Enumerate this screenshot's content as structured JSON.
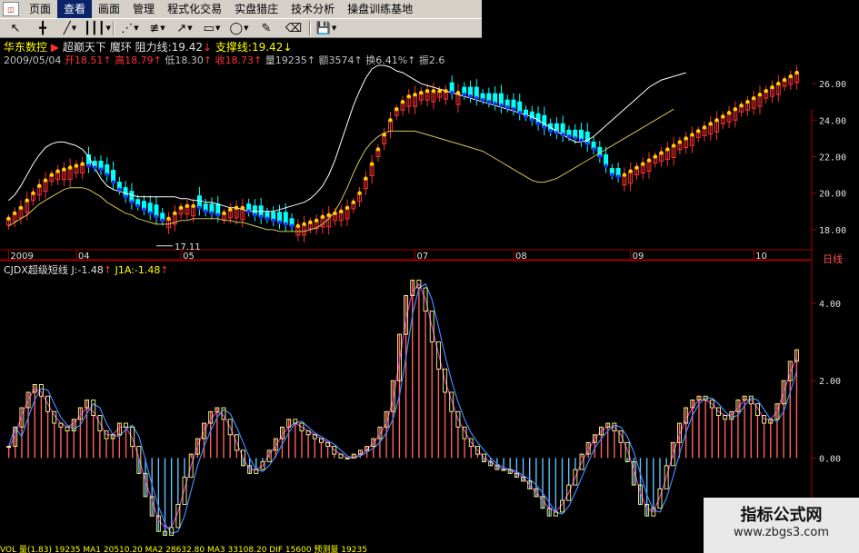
{
  "menu": {
    "items": [
      "页面",
      "查看",
      "画面",
      "管理",
      "程式化交易",
      "实盘猎庄",
      "技术分析",
      "操盘训练基地"
    ],
    "active_index": 1
  },
  "toolbar": {
    "tools": [
      "select-arrow-icon",
      "cross-icon",
      "line-icon",
      "bars-icon",
      "fan-icon",
      "channel-icon",
      "arrow-icon",
      "rect-icon",
      "ellipse-icon",
      "pen-icon",
      "eraser-icon",
      "save-icon"
    ]
  },
  "info": {
    "stock_name": "华东数控",
    "marker": "▶",
    "formula_name": "超巅天下",
    "sub_name": "魔环",
    "resistance_label": "阻力线",
    "resistance_value": "19.42",
    "resistance_arrow": "↓",
    "support_label": "支撑线",
    "support_value": "19.42",
    "support_arrow": "↓",
    "date": "2009/05/04",
    "open_label": "开",
    "open": "18.51",
    "open_arrow": "↑",
    "high_label": "高",
    "high": "18.79",
    "high_arrow": "↑",
    "low_label": "低",
    "low": "18.30",
    "low_arrow": "↑",
    "close_label": "收",
    "close": "18.73",
    "close_arrow": "↑",
    "vol_label": "量",
    "vol": "19235",
    "vol_arrow": "↑",
    "amt_label": "额",
    "amt": "3574",
    "amt_arrow": "↑",
    "turnover_label": "换",
    "turnover": "6.41%",
    "turnover_arrow": "↑",
    "amp_label": "振",
    "amp": "2.6"
  },
  "indicator": {
    "name": "CJDX超级短线",
    "j_label": "J:",
    "j_value": "-1.48",
    "j_arrow": "↑",
    "j1_label": "J1A:",
    "j1_value": "-1.48",
    "j1_arrow": "↑"
  },
  "period_label": "日线",
  "low_annotation": "17.11",
  "watermark": {
    "line1": "指标公式网",
    "line2": "www.zbgs3.com"
  },
  "bottom_text": "VOL 量(1.83)  19235 MA1  20510.20  MA2  28632.80  MA3  33108.20  DIF 15600  预测量  19235",
  "colors": {
    "up": "#ff3030",
    "down": "#00ffff",
    "accent": "#ffff00",
    "band": "#d9c35a",
    "upper": "#ffffff",
    "maup": "#ffd000",
    "madown": "#2233ff",
    "j": "#ffff80",
    "j1": "#cc33cc",
    "j2": "#4488ff",
    "hist_up": "#ff6060",
    "hist_down": "#60c0ff"
  },
  "chart_data": [
    {
      "type": "candlestick",
      "title": "",
      "x_labels": [
        "2009",
        "04",
        "05",
        "07",
        "08",
        "09",
        "10"
      ],
      "y_ticks": [
        18.0,
        20.0,
        22.0,
        24.0,
        26.0
      ],
      "ylim": [
        17.0,
        27.0
      ],
      "grid": false,
      "x": [
        0,
        1,
        2,
        3,
        4,
        5,
        6,
        7,
        8,
        9,
        10,
        11,
        12,
        13,
        14,
        15,
        16,
        17,
        18,
        19,
        20,
        21,
        22,
        23,
        24,
        25,
        26,
        27,
        28,
        29,
        30,
        31,
        32,
        33,
        34,
        35,
        36,
        37,
        38,
        39,
        40,
        41,
        42,
        43,
        44,
        45,
        46,
        47,
        48,
        49,
        50,
        51,
        52,
        53,
        54,
        55,
        56,
        57,
        58,
        59,
        60,
        61,
        62,
        63,
        64,
        65,
        66,
        67,
        68,
        69,
        70,
        71,
        72,
        73,
        74,
        75,
        76,
        77,
        78,
        79,
        80,
        81,
        82,
        83,
        84,
        85,
        86,
        87,
        88,
        89,
        90,
        91,
        92,
        93,
        94,
        95,
        96,
        97,
        98,
        99,
        100,
        101,
        102,
        103,
        104,
        105,
        106,
        107,
        108,
        109,
        110,
        111,
        112,
        113,
        114,
        115,
        116,
        117,
        118,
        119,
        120,
        121,
        122,
        123,
        124,
        125,
        126,
        127,
        128,
        129,
        130,
        131,
        132,
        133,
        134,
        135,
        136,
        137,
        138,
        139,
        140,
        141,
        142,
        143,
        144,
        145,
        146,
        147,
        148,
        149
      ],
      "close": [
        18.6,
        18.9,
        19.2,
        19.6,
        20.0,
        20.4,
        20.7,
        21.0,
        21.2,
        21.3,
        21.4,
        21.5,
        21.6,
        21.5,
        21.4,
        21.3,
        21.0,
        20.6,
        20.2,
        19.8,
        19.5,
        19.3,
        19.1,
        18.9,
        18.7,
        18.5,
        18.6,
        18.9,
        19.2,
        19.3,
        19.3,
        19.2,
        19.0,
        18.9,
        18.8,
        18.9,
        19.1,
        19.2,
        19.2,
        19.0,
        18.8,
        18.7,
        18.6,
        18.5,
        18.4,
        18.3,
        18.2,
        18.2,
        18.3,
        18.4,
        18.5,
        18.7,
        18.8,
        18.9,
        19.0,
        19.2,
        19.5,
        20.0,
        20.8,
        21.6,
        22.4,
        23.2,
        24.0,
        24.6,
        25.0,
        25.3,
        25.4,
        25.5,
        25.6,
        25.6,
        25.6,
        25.6,
        25.5,
        25.5,
        25.4,
        25.3,
        25.2,
        25.1,
        25.0,
        24.9,
        24.8,
        24.7,
        24.6,
        24.4,
        24.2,
        24.0,
        23.8,
        23.6,
        23.4,
        23.3,
        23.2,
        23.1,
        23.0,
        22.9,
        22.7,
        22.4,
        22.0,
        21.5,
        21.0,
        20.9,
        21.0,
        21.2,
        21.4,
        21.6,
        21.8,
        22.0,
        22.2,
        22.4,
        22.6,
        22.8,
        23.0,
        23.2,
        23.4,
        23.6,
        23.8,
        24.0,
        24.2,
        24.4,
        24.6,
        24.8,
        25.0,
        25.2,
        25.4,
        25.6,
        25.8,
        26.0,
        26.2,
        26.4,
        26.6
      ],
      "upper": [
        19.6,
        19.9,
        20.4,
        21.0,
        21.6,
        22.1,
        22.5,
        22.7,
        22.8,
        22.8,
        22.7,
        22.6,
        22.4,
        22.0,
        21.4,
        20.8,
        20.4,
        20.2,
        20.1,
        20.0,
        19.9,
        19.8,
        19.8,
        19.8,
        19.8,
        19.8,
        19.8,
        19.8,
        19.7,
        19.7,
        19.6,
        19.6,
        19.5,
        19.5,
        19.4,
        19.3,
        19.2,
        19.2,
        19.1,
        19.0,
        19.0,
        19.0,
        19.0,
        19.0,
        19.1,
        19.2,
        19.3,
        19.4,
        19.5,
        19.7,
        20.0,
        20.4,
        21.0,
        21.8,
        22.8,
        23.8,
        24.8,
        25.6,
        26.3,
        26.8,
        27.0,
        27.0,
        26.9,
        26.7,
        26.6,
        26.4,
        26.2,
        26.0,
        25.9,
        25.8,
        25.7,
        25.6,
        25.5,
        25.4,
        25.3,
        25.2,
        25.1,
        25.0,
        24.9,
        24.8,
        24.7,
        24.6,
        24.5,
        24.4,
        24.3,
        24.2,
        24.0,
        23.8,
        23.6,
        23.4,
        23.2,
        23.0,
        22.8,
        22.8,
        22.9,
        23.1,
        23.4,
        23.7,
        24.0,
        24.3,
        24.6,
        24.9,
        25.2,
        25.5,
        25.8,
        26.0,
        26.2,
        26.3,
        26.4,
        26.5,
        26.6
      ],
      "lower": [
        18.2,
        18.4,
        18.6,
        18.8,
        19.1,
        19.4,
        19.6,
        19.8,
        20.0,
        20.2,
        20.3,
        20.3,
        20.3,
        20.2,
        20.0,
        19.8,
        19.5,
        19.3,
        19.1,
        18.9,
        18.8,
        18.6,
        18.5,
        18.4,
        18.3,
        18.3,
        18.3,
        18.4,
        18.5,
        18.5,
        18.6,
        18.6,
        18.6,
        18.6,
        18.6,
        18.5,
        18.5,
        18.4,
        18.4,
        18.3,
        18.2,
        18.1,
        18.0,
        18.0,
        17.9,
        17.9,
        17.9,
        17.9,
        17.9,
        18.0,
        18.1,
        18.3,
        18.6,
        19.0,
        19.6,
        20.3,
        21.1,
        21.8,
        22.4,
        22.8,
        23.1,
        23.3,
        23.4,
        23.4,
        23.4,
        23.4,
        23.4,
        23.3,
        23.2,
        23.1,
        23.0,
        22.9,
        22.8,
        22.7,
        22.6,
        22.5,
        22.4,
        22.3,
        22.1,
        21.9,
        21.7,
        21.5,
        21.3,
        21.1,
        20.9,
        20.7,
        20.6,
        20.6,
        20.7,
        20.8,
        21.0,
        21.2,
        21.4,
        21.6,
        21.8,
        22.0,
        22.2,
        22.4,
        22.6,
        22.8,
        23.0,
        23.2,
        23.4,
        23.6,
        23.8,
        24.0,
        24.2,
        24.4,
        24.6
      ],
      "low_point": {
        "value": 17.11
      }
    },
    {
      "type": "bar",
      "title": "",
      "y_ticks": [
        0.0,
        2.0,
        4.0
      ],
      "ylim": [
        -2.2,
        4.8
      ],
      "series": [
        {
          "name": "J",
          "values": [
            0.3,
            0.8,
            1.3,
            1.7,
            1.9,
            1.6,
            1.2,
            0.9,
            0.8,
            0.7,
            1.0,
            1.3,
            1.5,
            1.1,
            0.7,
            0.5,
            0.6,
            0.9,
            0.8,
            0.3,
            -0.4,
            -1.0,
            -1.5,
            -1.9,
            -2.0,
            -1.8,
            -1.2,
            -0.5,
            0.1,
            0.5,
            0.9,
            1.2,
            1.3,
            1.0,
            0.6,
            0.2,
            -0.2,
            -0.4,
            -0.3,
            -0.1,
            0.2,
            0.5,
            0.8,
            1.0,
            0.9,
            0.7,
            0.6,
            0.5,
            0.4,
            0.3,
            0.1,
            0.0,
            0.0,
            0.1,
            0.2,
            0.3,
            0.5,
            0.8,
            1.2,
            2.0,
            3.2,
            4.2,
            4.6,
            4.4,
            3.8,
            3.0,
            2.3,
            1.7,
            1.2,
            0.8,
            0.5,
            0.3,
            0.1,
            -0.1,
            -0.2,
            -0.3,
            -0.3,
            -0.4,
            -0.5,
            -0.6,
            -0.8,
            -1.0,
            -1.3,
            -1.5,
            -1.4,
            -1.1,
            -0.7,
            -0.3,
            0.1,
            0.4,
            0.6,
            0.8,
            0.9,
            0.7,
            0.4,
            -0.1,
            -0.7,
            -1.2,
            -1.5,
            -1.3,
            -0.8,
            -0.2,
            0.4,
            0.9,
            1.3,
            1.5,
            1.6,
            1.5,
            1.3,
            1.1,
            1.0,
            1.2,
            1.5,
            1.6,
            1.4,
            1.1,
            0.9,
            1.0,
            1.4,
            2.0,
            2.5,
            2.8
          ]
        },
        {
          "name": "J1A",
          "values": [
            0.2,
            0.6,
            1.1,
            1.5,
            1.8,
            1.7,
            1.4,
            1.1,
            0.9,
            0.8,
            0.9,
            1.1,
            1.3,
            1.2,
            0.9,
            0.6,
            0.6,
            0.8,
            0.8,
            0.5,
            0.0,
            -0.6,
            -1.1,
            -1.6,
            -1.8,
            -1.8,
            -1.4,
            -0.8,
            -0.2,
            0.3,
            0.7,
            1.0,
            1.2,
            1.1,
            0.8,
            0.4,
            0.0,
            -0.3,
            -0.3,
            -0.2,
            0.1,
            0.3,
            0.6,
            0.8,
            0.9,
            0.8,
            0.7,
            0.6,
            0.5,
            0.4,
            0.2,
            0.1,
            0.0,
            0.0,
            0.1,
            0.2,
            0.4,
            0.6,
            0.9,
            1.5,
            2.5,
            3.6,
            4.3,
            4.5,
            4.1,
            3.4,
            2.7,
            2.0,
            1.5,
            1.0,
            0.7,
            0.4,
            0.2,
            0.0,
            -0.1,
            -0.2,
            -0.3,
            -0.3,
            -0.4,
            -0.5,
            -0.7,
            -0.9,
            -1.1,
            -1.3,
            -1.4,
            -1.2,
            -0.9,
            -0.5,
            -0.1,
            0.2,
            0.5,
            0.7,
            0.8,
            0.8,
            0.6,
            0.2,
            -0.3,
            -0.9,
            -1.3,
            -1.4,
            -1.0,
            -0.5,
            0.1,
            0.6,
            1.0,
            1.3,
            1.5,
            1.5,
            1.4,
            1.2,
            1.1,
            1.1,
            1.3,
            1.5,
            1.5,
            1.3,
            1.0,
            1.0,
            1.2,
            1.7,
            2.2,
            2.6
          ]
        }
      ]
    }
  ]
}
